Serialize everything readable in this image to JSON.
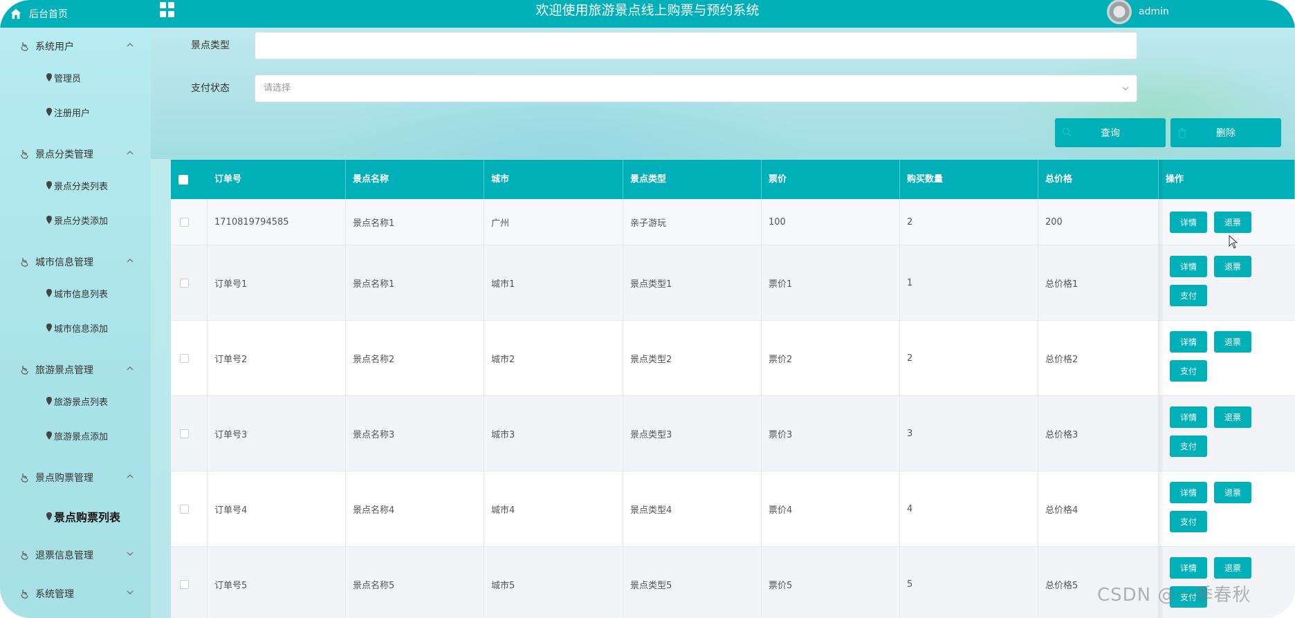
{
  "header": {
    "home_label": "后台首页",
    "title": "欢迎使用旅游景点线上购票与预约系统",
    "username": "admin",
    "icons": [
      "home-icon",
      "grid-menu-icon",
      "avatar"
    ]
  },
  "sidebar": {
    "groups": [
      {
        "label": "系统用户",
        "items": [
          "管理员",
          "注册用户"
        ],
        "expanded": true
      },
      {
        "label": "景点分类管理",
        "items": [
          "景点分类列表",
          "景点分类添加"
        ],
        "expanded": true
      },
      {
        "label": "城市信息管理",
        "items": [
          "城市信息列表",
          "城市信息添加"
        ],
        "expanded": true
      },
      {
        "label": "旅游景点管理",
        "items": [
          "旅游景点列表",
          "旅游景点添加"
        ],
        "expanded": true
      },
      {
        "label": "景点购票管理",
        "items": [
          "景点购票列表"
        ],
        "expanded": true
      },
      {
        "label": "退票信息管理",
        "items": [],
        "expanded": false
      },
      {
        "label": "系统管理",
        "items": [],
        "expanded": false
      }
    ],
    "active_item": "景点购票列表"
  },
  "search": {
    "type_label": "景点类型",
    "type_value": "",
    "pay_label": "支付状态",
    "pay_placeholder": "请选择",
    "query_button": "查询",
    "delete_button": "删除"
  },
  "table": {
    "columns": [
      "订单号",
      "景点名称",
      "城市",
      "景点类型",
      "票价",
      "购买数量",
      "总价格",
      "操作"
    ],
    "rows": [
      {
        "order": "1710819794585",
        "name": "景点名称1",
        "city": "广州",
        "type": "亲子游玩",
        "price": "100",
        "qty": "2",
        "total": "200",
        "actions": [
          "详情",
          "退票"
        ]
      },
      {
        "order": "订单号1",
        "name": "景点名称1",
        "city": "城市1",
        "type": "景点类型1",
        "price": "票价1",
        "qty": "1",
        "total": "总价格1",
        "actions": [
          "详情",
          "退票",
          "支付"
        ]
      },
      {
        "order": "订单号2",
        "name": "景点名称2",
        "city": "城市2",
        "type": "景点类型2",
        "price": "票价2",
        "qty": "2",
        "total": "总价格2",
        "actions": [
          "详情",
          "退票",
          "支付"
        ]
      },
      {
        "order": "订单号3",
        "name": "景点名称3",
        "city": "城市3",
        "type": "景点类型3",
        "price": "票价3",
        "qty": "3",
        "total": "总价格3",
        "actions": [
          "详情",
          "退票",
          "支付"
        ]
      },
      {
        "order": "订单号4",
        "name": "景点名称4",
        "city": "城市4",
        "type": "景点类型4",
        "price": "票价4",
        "qty": "4",
        "total": "总价格4",
        "actions": [
          "详情",
          "退票",
          "支付"
        ]
      },
      {
        "order": "订单号5",
        "name": "景点名称5",
        "city": "城市5",
        "type": "景点类型5",
        "price": "票价5",
        "qty": "5",
        "total": "总价格5",
        "actions": [
          "详情",
          "退票",
          "支付"
        ]
      }
    ]
  },
  "watermark": "CSDN @一季春秋",
  "colors": {
    "accent": "#00b0b8",
    "sidebar_bg": "#b6ecf1"
  }
}
